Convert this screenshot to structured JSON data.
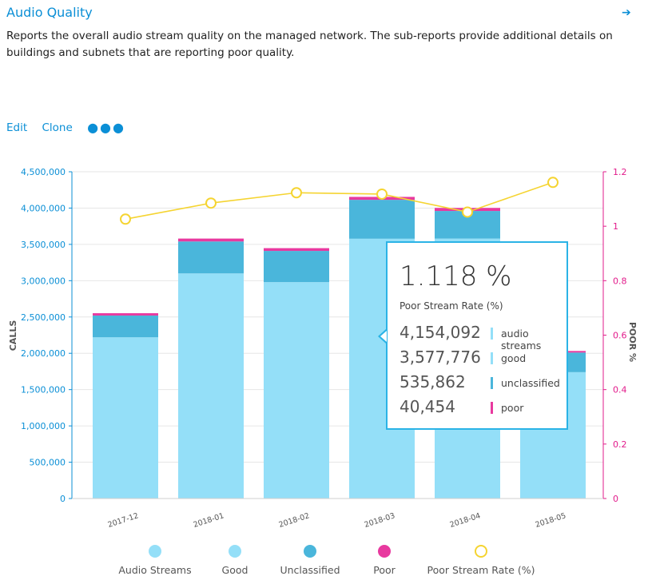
{
  "header": {
    "title": "Audio Quality",
    "arrow_icon": "arrow-right-icon",
    "description": "Reports the overall audio stream quality on the managed network. The sub-reports provide additional details on buildings and subnets that are reporting poor quality."
  },
  "actions": {
    "edit_label": "Edit",
    "clone_label": "Clone",
    "more_icon": "ellipsis-icon"
  },
  "colors": {
    "good": "#94dff8",
    "unclassified": "#4ab6db",
    "poor": "#e8399f",
    "line": "#f5d431",
    "axis_left": "#0b8fd6",
    "axis_right": "#e21b8b"
  },
  "chart_data": {
    "type": "bar",
    "stacked": true,
    "categories": [
      "2017-12",
      "2018-01",
      "2018-02",
      "2018-03",
      "2018-04",
      "2018-05"
    ],
    "series": [
      {
        "name": "Good",
        "values": [
          2220000,
          3100000,
          2980000,
          3577776,
          3580000,
          1740000
        ]
      },
      {
        "name": "Unclassified",
        "values": [
          300000,
          440000,
          430000,
          535862,
          380000,
          270000
        ]
      },
      {
        "name": "Poor",
        "values": [
          32000,
          40000,
          38000,
          40454,
          42000,
          22000
        ]
      }
    ],
    "line_series": {
      "name": "Poor Stream Rate (%)",
      "values": [
        1.026,
        1.085,
        1.123,
        1.118,
        1.052,
        1.161
      ]
    },
    "ylabel": "CALLS",
    "y2label": "POOR %",
    "ylim": [
      0,
      4500000
    ],
    "y2lim": [
      0,
      1.2
    ],
    "yticks": [
      "4,500,000",
      "4,000,000",
      "3,500,000",
      "3,000,000",
      "2,500,000",
      "2,000,000",
      "1,500,000",
      "1,000,000",
      "500,000",
      "0"
    ],
    "y2ticks": [
      "1.2",
      "1",
      "0.8",
      "0.6",
      "0.4",
      "0.2",
      "0"
    ],
    "grid": true,
    "legend_position": "bottom",
    "legend": [
      "Audio Streams",
      "Good",
      "Unclassified",
      "Poor",
      "Poor Stream Rate (%)"
    ]
  },
  "tooltip": {
    "big_value": "1.118 %",
    "subtitle": "Poor Stream Rate (%)",
    "rows": [
      {
        "value": "4,154,092",
        "label": "audio streams"
      },
      {
        "value": "3,577,776",
        "label": "good"
      },
      {
        "value": "535,862",
        "label": "unclassified"
      },
      {
        "value": "40,454",
        "label": "poor"
      }
    ]
  }
}
